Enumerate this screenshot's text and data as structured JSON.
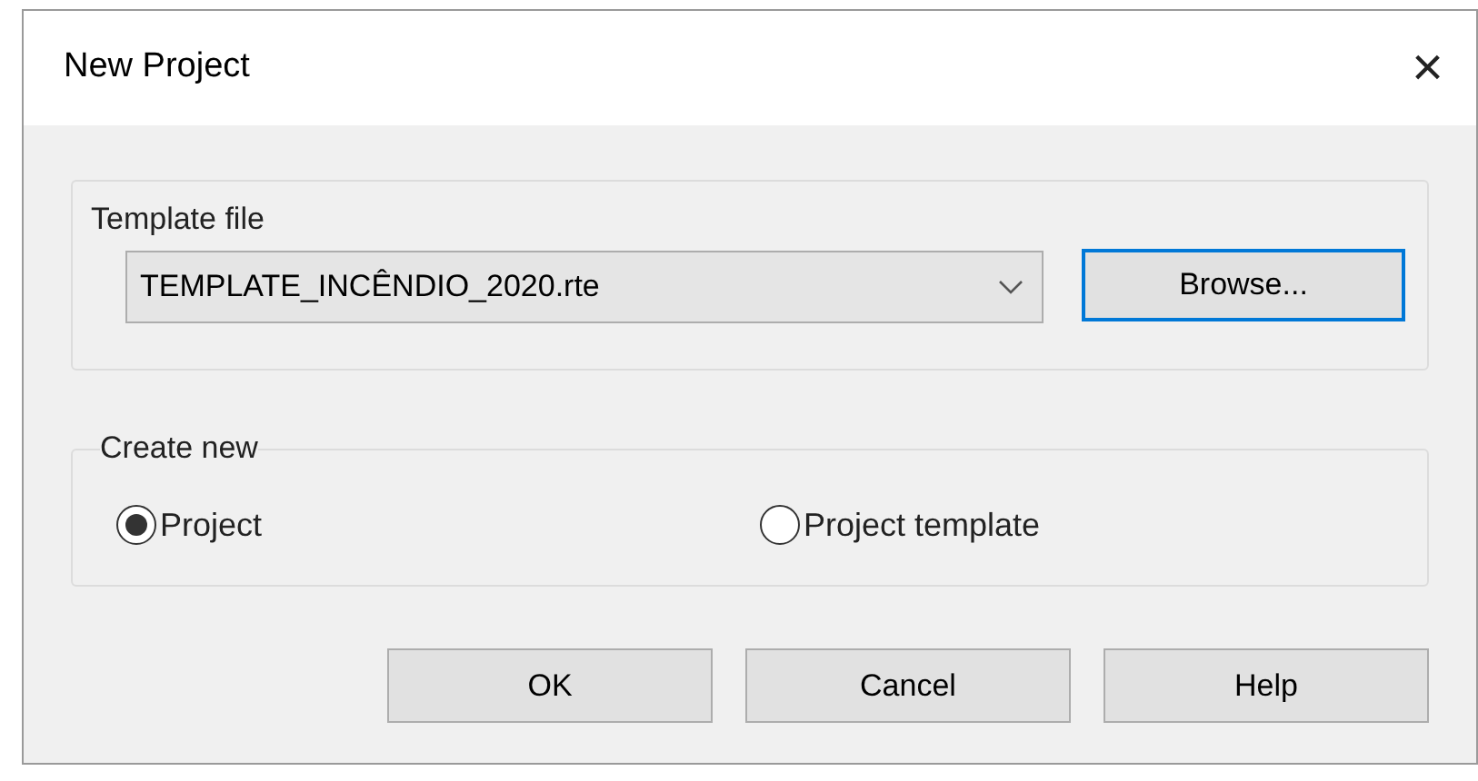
{
  "window": {
    "title": "New Project",
    "close": "×"
  },
  "template_file": {
    "label": "Template file",
    "value": "TEMPLATE_INCÊNDIO_2020.rte",
    "browse": "Browse..."
  },
  "create_new": {
    "label": "Create new",
    "options": [
      {
        "label": "Project",
        "selected": true
      },
      {
        "label": "Project template",
        "selected": false
      }
    ]
  },
  "buttons": [
    "OK",
    "Cancel",
    "Help"
  ]
}
